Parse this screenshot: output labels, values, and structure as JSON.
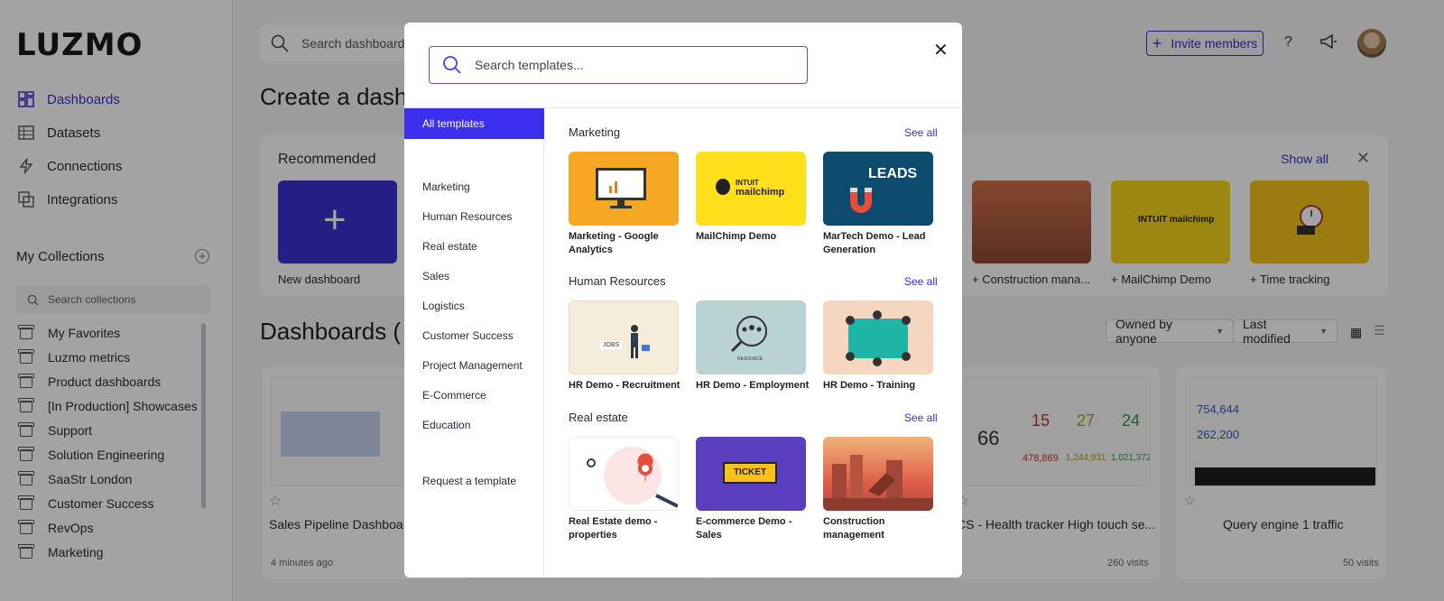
{
  "sidebar": {
    "logo": "LUZMO",
    "nav": [
      {
        "label": "Dashboards",
        "icon": "dashboards-icon",
        "active": true
      },
      {
        "label": "Datasets",
        "icon": "datasets-icon"
      },
      {
        "label": "Connections",
        "icon": "connections-icon"
      },
      {
        "label": "Integrations",
        "icon": "integrations-icon"
      }
    ],
    "collections_title": "My Collections",
    "collections_search_placeholder": "Search collections",
    "collections": [
      "My Favorites",
      "Luzmo metrics",
      "Product dashboards",
      "[In Production] Showcases",
      "Support",
      "Solution Engineering",
      "SaaStr London",
      "Customer Success",
      "RevOps",
      "Marketing"
    ]
  },
  "topbar": {
    "search_placeholder": "Search dashboards",
    "invite_label": "Invite members",
    "help_label": "?"
  },
  "create": {
    "heading": "Create a dash",
    "recommended_title": "Recommended",
    "show_all": "Show all",
    "cards": [
      "New dashboard",
      "Construction mana...",
      "MailChimp Demo",
      "Time tracking"
    ]
  },
  "dashboards": {
    "heading": "Dashboards (",
    "filter_owner": "Owned by anyone",
    "filter_sort": "Last modified",
    "cards": [
      {
        "title": "Sales Pipeline Dashboa",
        "meta": "4 minutes ago"
      },
      {
        "title": "CS - Health tracker High touch se...",
        "meta": "260 visits",
        "kpis": [
          "66",
          "15",
          "27",
          "24",
          "478,869",
          "1,244,931",
          "1,021,372"
        ]
      },
      {
        "title": "Query engine 1 traffic",
        "meta": "50 visits",
        "kpis": [
          "754,644",
          "262,200"
        ]
      }
    ]
  },
  "modal": {
    "search_placeholder": "Search templates...",
    "close_label": "✕",
    "categories": [
      "All templates",
      "Marketing",
      "Human Resources",
      "Real estate",
      "Sales",
      "Logistics",
      "Customer Success",
      "Project Management",
      "E-Commerce",
      "Education",
      "Request a template"
    ],
    "see_all": "See all",
    "sections": [
      {
        "title": "Marketing",
        "items": [
          "Marketing - Google Analytics",
          "MailChimp Demo",
          "MarTech Demo - Lead Generation"
        ]
      },
      {
        "title": "Human Resources",
        "items": [
          "HR Demo - Recruitment",
          "HR Demo - Employment",
          "HR Demo - Training"
        ]
      },
      {
        "title": "Real estate",
        "items": [
          "Real Estate demo - properties",
          "E-commerce Demo - Sales",
          "Construction management"
        ]
      }
    ],
    "thumb_text": {
      "mailchimp_1": "INTUIT",
      "mailchimp_2": "mailchimp",
      "leads": "LEADS",
      "resource": "RESOURCE",
      "ticket": "TICKET",
      "jobs": "JOBS"
    }
  },
  "colors": {
    "accent": "#3d2ff0",
    "link": "#3a2fd0"
  }
}
